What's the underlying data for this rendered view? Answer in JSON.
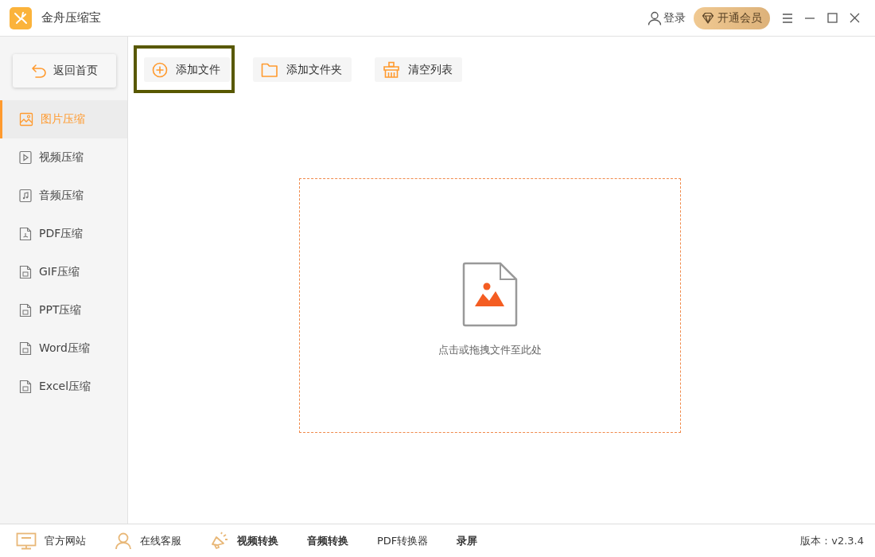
{
  "app": {
    "title": "金舟压缩宝"
  },
  "header": {
    "login": "登录",
    "vip": "开通会员"
  },
  "sidebar": {
    "back": "返回首页",
    "items": [
      {
        "label": "图片压缩",
        "kind": "image",
        "selected": true
      },
      {
        "label": "视频压缩",
        "kind": "video",
        "selected": false
      },
      {
        "label": "音频压缩",
        "kind": "audio",
        "selected": false
      },
      {
        "label": "PDF压缩",
        "kind": "pdf",
        "selected": false
      },
      {
        "label": "GIF压缩",
        "kind": "doc",
        "selected": false
      },
      {
        "label": "PPT压缩",
        "kind": "doc",
        "selected": false
      },
      {
        "label": "Word压缩",
        "kind": "doc",
        "selected": false
      },
      {
        "label": "Excel压缩",
        "kind": "doc",
        "selected": false
      }
    ]
  },
  "toolbar": [
    {
      "label": "添加文件",
      "kind": "add",
      "highlighted": true
    },
    {
      "label": "添加文件夹",
      "kind": "folder",
      "highlighted": false
    },
    {
      "label": "清空列表",
      "kind": "clear",
      "highlighted": false
    }
  ],
  "dropzone": {
    "hint": "点击或拖拽文件至此处"
  },
  "footer": {
    "links": [
      {
        "label": "官方网站",
        "kind": "website",
        "bold": false
      },
      {
        "label": "在线客服",
        "kind": "support",
        "bold": false
      },
      {
        "label": "视频转换",
        "kind": "promo",
        "bold": true
      },
      {
        "label": "音频转换",
        "kind": "text",
        "bold": true
      },
      {
        "label": "PDF转换器",
        "kind": "text",
        "bold": false
      },
      {
        "label": "录屏",
        "kind": "text",
        "bold": true
      }
    ],
    "version": "版本：v2.3.4"
  }
}
